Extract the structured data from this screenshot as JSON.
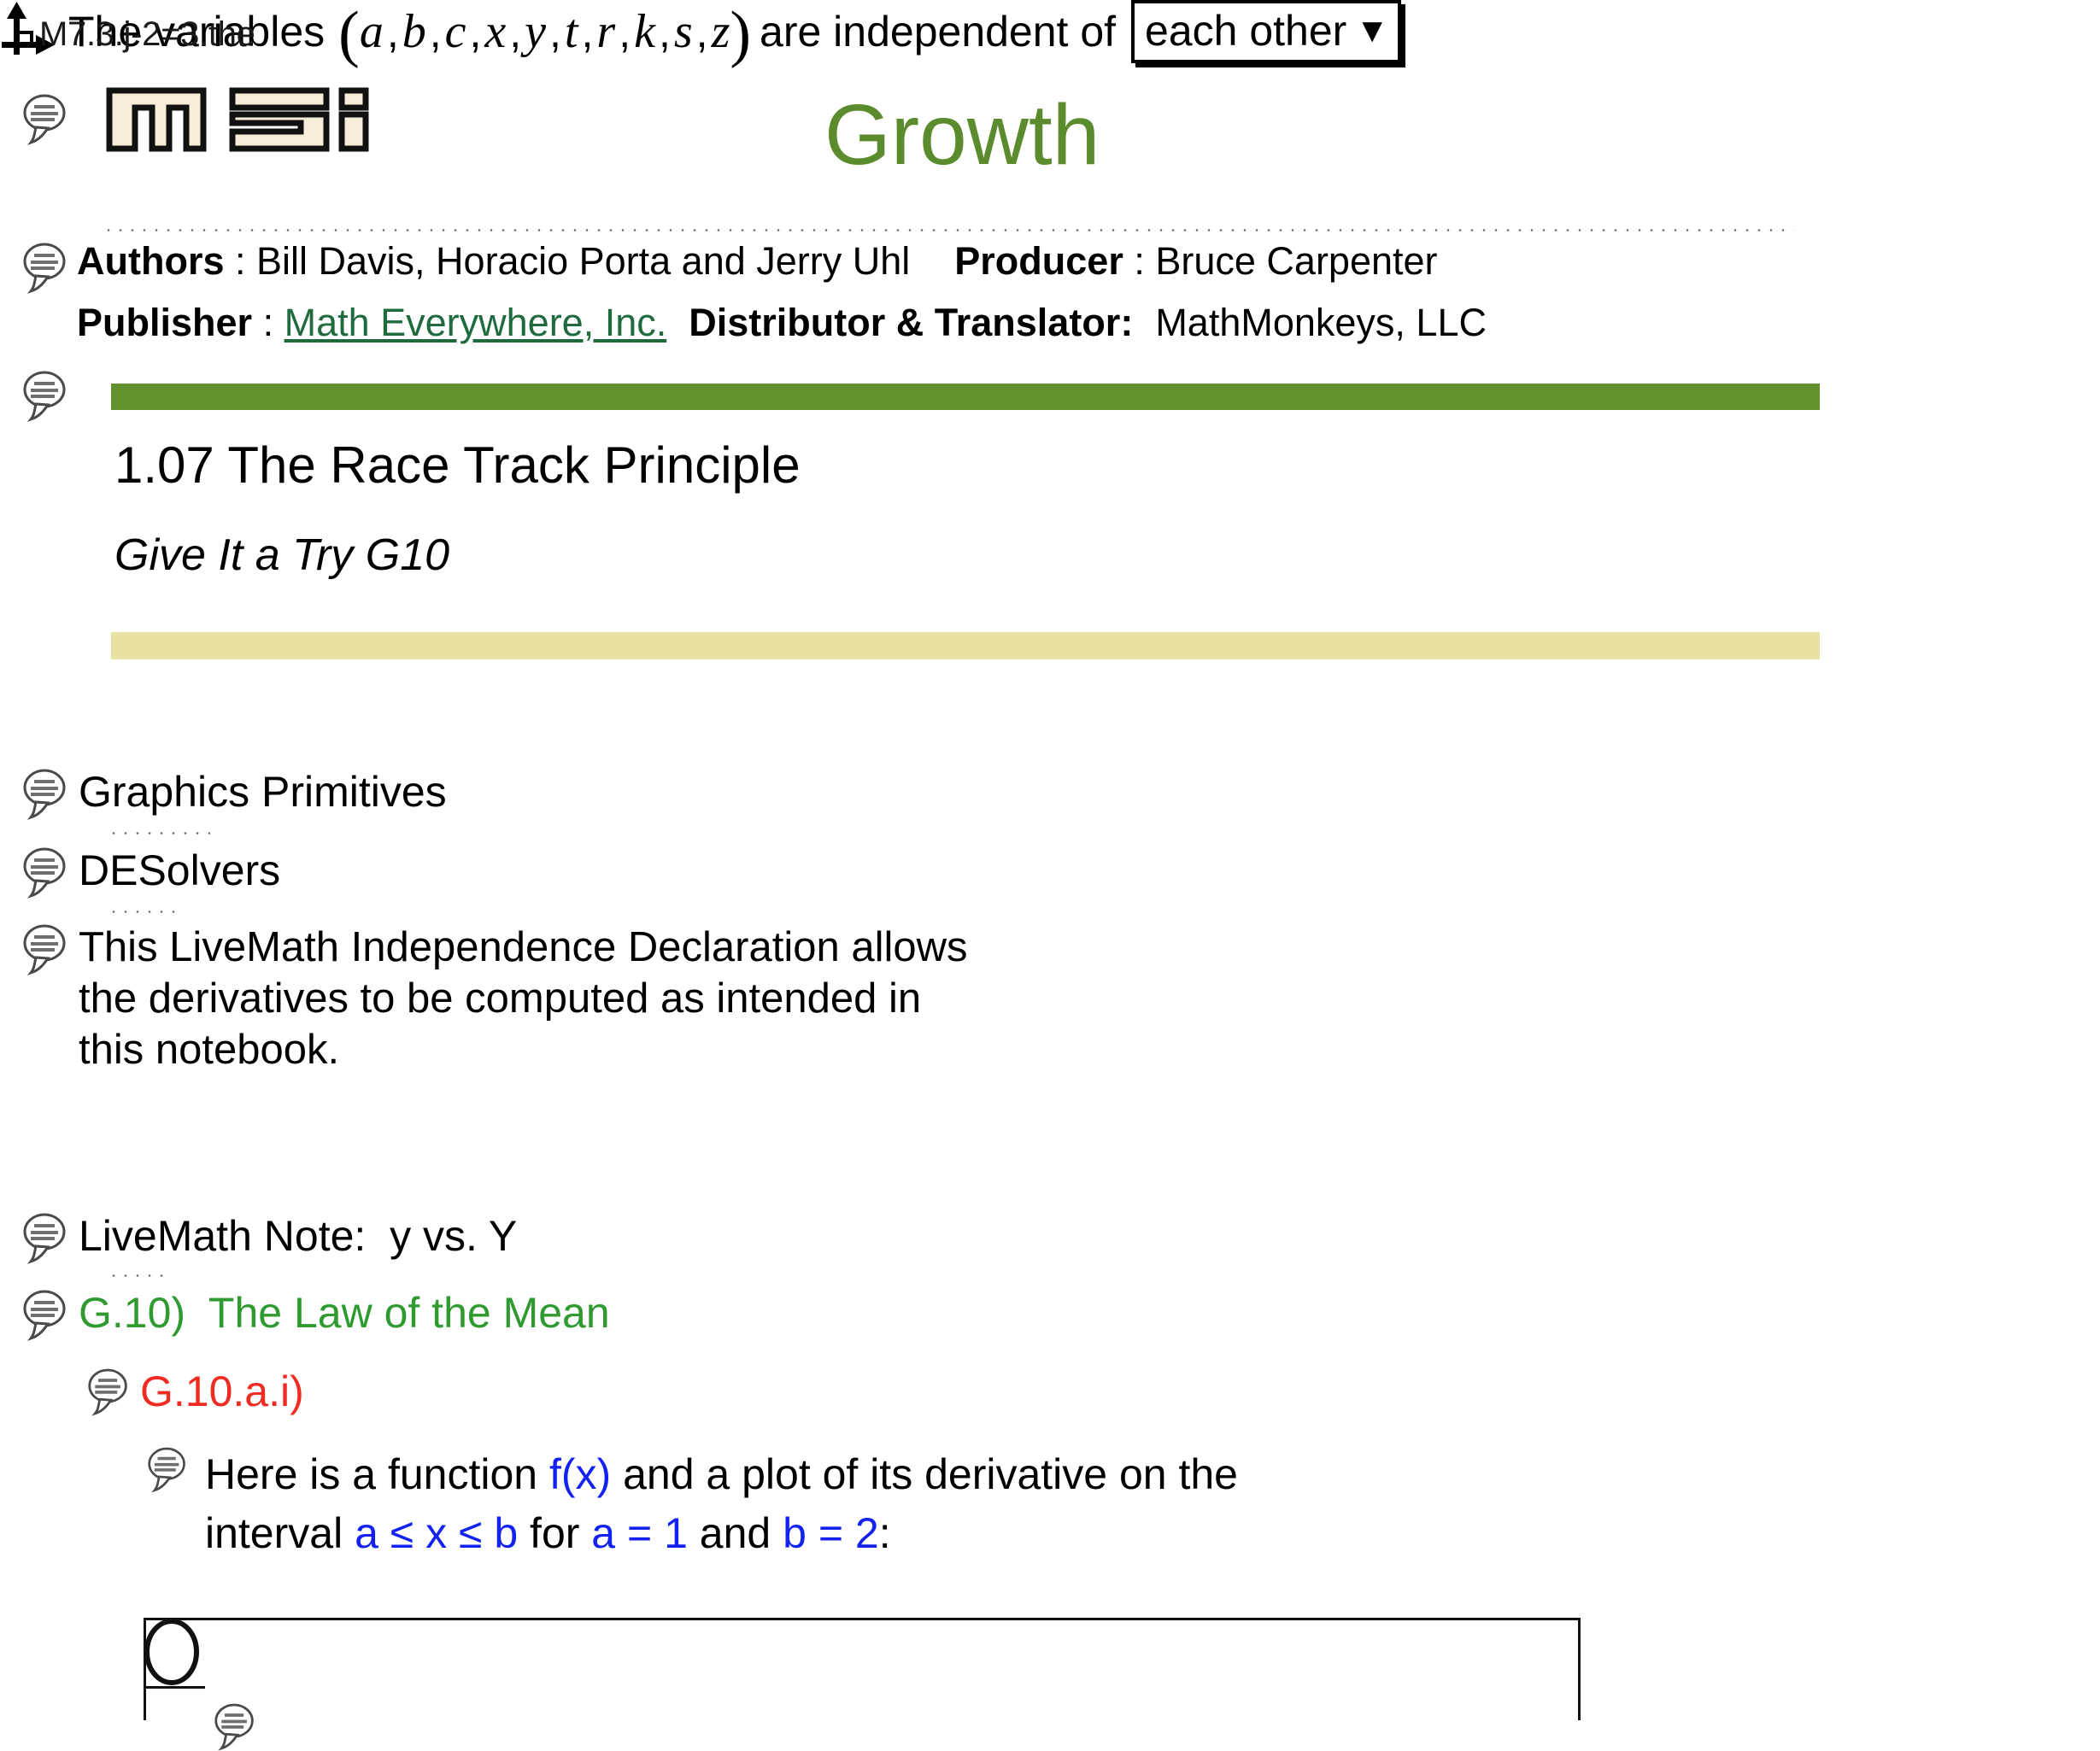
{
  "document": {
    "filename": "M7.3.j-2=3.the",
    "title": "Growth",
    "title_color": "#5b8b2d"
  },
  "logo": {
    "name": "mei",
    "alt": "MEI Math Everywhere Inc logo",
    "fill": "#f7eeda"
  },
  "credits": {
    "authors_label": "Authors",
    "authors_sep": " : ",
    "authors_value": "Bill Davis, Horacio Porta and Jerry Uhl",
    "producer_label": "Producer",
    "producer_sep": " : ",
    "producer_value": "Bruce Carpenter",
    "publisher_label": "Publisher",
    "publisher_sep": " : ",
    "publisher_link": "Math Everywhere, Inc.",
    "publisher_link_color": "#1f6b3e",
    "distributor_label": "Distributor & Translator:",
    "distributor_value": "MathMonkeys, LLC"
  },
  "section": {
    "number_and_title": "1.07  The Race Track Principle",
    "subtitle": "Give It a Try G10",
    "bar_top_color": "#62912e",
    "bar_bottom_color": "#e7e2a1"
  },
  "outline": {
    "item_graphics_primitives": "Graphics Primitives",
    "item_desolvers": "DESolvers",
    "independence_note_line1": "This LiveMath Independence Declaration allows",
    "independence_note_line2": "the derivatives to be computed as intended in",
    "independence_note_line3": "this notebook.",
    "item_livemath_note": "LiveMath Note:  y vs. Y",
    "item_g10": "G.10)  The Law of the Mean",
    "item_g10_color": "#2f9a2f",
    "item_g10ai": "G.10.a.i)",
    "item_g10ai_color": "#ef2b22"
  },
  "independence_declaration": {
    "lead": "The variables",
    "open_paren": "(",
    "variables": [
      "a",
      "b",
      "c",
      "x",
      "y",
      "t",
      "r",
      "k",
      "s",
      "z"
    ],
    "close_paren": ")",
    "trailing": "are independent of",
    "dropdown_value": "each other",
    "dropdown_caret": "▼"
  },
  "g10ai_body": {
    "line1_part1": "Here is a function ",
    "line1_fx": "f(x)",
    "line1_part2": " and a plot of its derivative on the",
    "line2_part1": "interval ",
    "line2_interval": "a ≤ x ≤ b",
    "line2_part2": " for ",
    "line2_a_eq": "a  =  1",
    "line2_part3": " and ",
    "line2_b_eq": "b  =  2",
    "line2_colon": ":",
    "math_color": "#1322f0"
  },
  "icons": {
    "comment_bubble": "comment-bubble-icon",
    "axes_arrows": "axes-arrows-icon",
    "oval_handle": "oval-handle-icon",
    "caret_down": "chevron-down-icon"
  }
}
